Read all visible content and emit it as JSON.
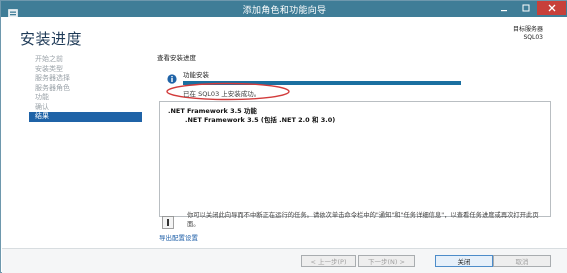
{
  "window": {
    "title": "添加角色和功能向导",
    "minimize_glyph": "—",
    "maximize_glyph": "☐",
    "close_glyph": "✕"
  },
  "page": {
    "title": "安装进度",
    "destination_label": "目标服务器",
    "destination_server": "SQL03"
  },
  "nav": {
    "items": [
      {
        "label": "开始之前",
        "active": false
      },
      {
        "label": "安装类型",
        "active": false
      },
      {
        "label": "服务器选择",
        "active": false
      },
      {
        "label": "服务器角色",
        "active": false
      },
      {
        "label": "功能",
        "active": false
      },
      {
        "label": "确认",
        "active": false
      },
      {
        "label": "结果",
        "active": true
      }
    ]
  },
  "main": {
    "heading": "查看安装进度",
    "feature_status_label": "功能安装",
    "progress_value": 1.0,
    "success_message": "已在 SQL03 上安装成功。",
    "results": {
      "line1": ".NET Framework 3.5 功能",
      "line2": ".NET Framework 3.5 (包括 .NET 2.0 和 3.0)"
    },
    "note": "你可以关闭此向导而不中断正在运行的任务。请依次单击命令栏中的\"通知\"和\"任务详细信息\"，以查看任务进度或再次打开此页面。",
    "export_link": "导出配置设置"
  },
  "footer": {
    "prev_label": "< 上一步(P)",
    "next_label": "下一步(N) >",
    "close_label": "关闭",
    "cancel_label": "取消"
  },
  "colors": {
    "titlebar": "#3f7d97",
    "nav_active": "#1f63a7",
    "progress_fill": "#1a6fa0",
    "annotation_red": "#d23b3b",
    "link": "#1e5fa8"
  },
  "icons": {
    "app": "server-manager-icon",
    "info": "info-icon",
    "note": "note-icon"
  }
}
